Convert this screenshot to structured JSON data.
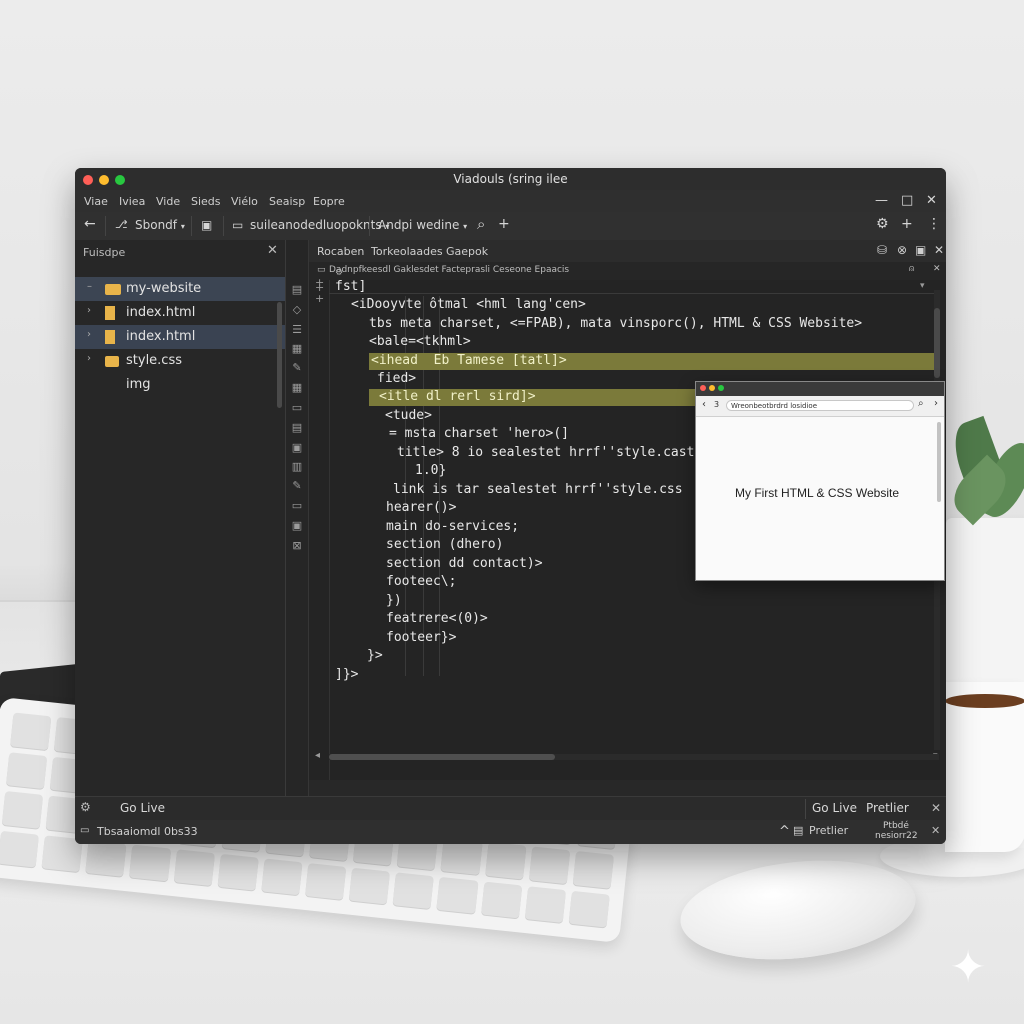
{
  "window": {
    "title": "Viadouls (sring ilee",
    "traffic_colors": [
      "#ff5f57",
      "#febc2e",
      "#28c840"
    ]
  },
  "menu": [
    "Viae",
    "Iviea",
    "Vide",
    "Sieds",
    "Viélo",
    "Seaisp",
    "Eopre"
  ],
  "window_controls": {
    "minimize": "—",
    "maximize": "□",
    "close": "✕"
  },
  "toolbar": {
    "back": "←",
    "branch": "Sbondf",
    "project": "suileanodedluopoknts",
    "app": "Andpi wedine",
    "search": "⌕",
    "add": "+",
    "settings": "⚙",
    "add2": "+",
    "more": "⋮"
  },
  "sidebar": {
    "title": "Fuisdpe",
    "close": "✕",
    "folder_color": "#e8b44a",
    "items": [
      {
        "arrow": "–",
        "label": "my-website"
      },
      {
        "arrow": "›",
        "label": "index.html"
      },
      {
        "arrow": "›",
        "label": "index.html"
      },
      {
        "arrow": "›",
        "label": "style.css"
      },
      {
        "arrow": "",
        "label": "img"
      }
    ]
  },
  "tabs": [
    "Rocaben",
    "Torkeolaades",
    "Gaepok"
  ],
  "breadcrumb": "Dadnpfkeesdl Gaklesdet Facteprasli Ceseone Epaacis",
  "gutter": [
    "+",
    "+",
    "+"
  ],
  "code_lines": [
    "fst]",
    "<iDooyvte ôtmal <hml lang'cen>",
    "tbs meta charset, <=FPAB), mata vinsporc(), HTML & CSS Website>",
    "<bale=<tkhml>",
    "<ihead  Eb Tamese [tatl]>",
    "fied>",
    "<itle dl rerl sird]>",
    "<tude>",
    "= msta charset 'hero>(]",
    "title> 8 io sealestet hrrf''style.cast)>",
    "1.0}",
    "link is tar sealestet hrrf''style.css",
    "hearer()>",
    "main do-services;",
    "section (dhero)",
    "section dd contact)>",
    "footeec\\;",
    "})",
    "featrere<(0)>",
    "footeer}>",
    "}>",
    "]}>"
  ],
  "preview": {
    "address": "Wreonbeotbrdrd losidioe",
    "nav_back": "‹",
    "nav_reload": "3",
    "heading": "My First HTML & CSS Website"
  },
  "panel": {
    "settings": "⚙",
    "go_live_left": "Go Live",
    "go_live_right": "Go Live",
    "prettier": "Pretlier",
    "close": "✕"
  },
  "status": {
    "left": "Tbsaaiomdl 0bs33",
    "caret": "^",
    "prettier": "Pretlier",
    "right_line1": "Ptbdé",
    "right_line2": "nesiorr22",
    "close": "✕"
  },
  "desk": {
    "sparkle": "✦"
  }
}
